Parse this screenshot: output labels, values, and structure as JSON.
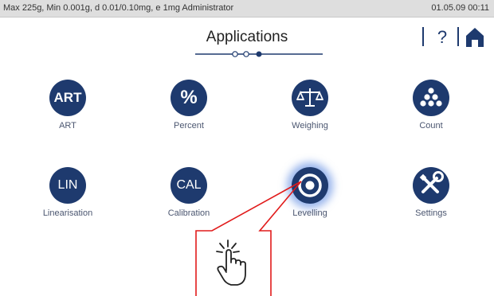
{
  "status_bar": {
    "info": "Max 225g, Min 0.001g, d 0.01/0.10mg, e 1mg  Administrator",
    "datetime": "01.05.09 00:11"
  },
  "header": {
    "title": "Applications",
    "help_label": "?"
  },
  "apps": [
    {
      "icon_text": "ART",
      "label": "ART",
      "icon": "art-icon"
    },
    {
      "icon_text": "%",
      "label": "Percent",
      "icon": "percent-icon"
    },
    {
      "icon_text": "",
      "label": "Weighing",
      "icon": "scale-icon"
    },
    {
      "icon_text": "",
      "label": "Count",
      "icon": "count-dots-icon"
    },
    {
      "icon_text": "LIN",
      "label": "Linearisation",
      "icon": "lin-icon"
    },
    {
      "icon_text": "CAL",
      "label": "Calibration",
      "icon": "cal-icon"
    },
    {
      "icon_text": "",
      "label": "Levelling",
      "icon": "target-icon"
    },
    {
      "icon_text": "",
      "label": "Settings",
      "icon": "wrench-screwdriver-icon"
    }
  ],
  "colors": {
    "primary": "#1e3a6e",
    "callout": "#e11b1b",
    "status_bg": "#dedede"
  }
}
